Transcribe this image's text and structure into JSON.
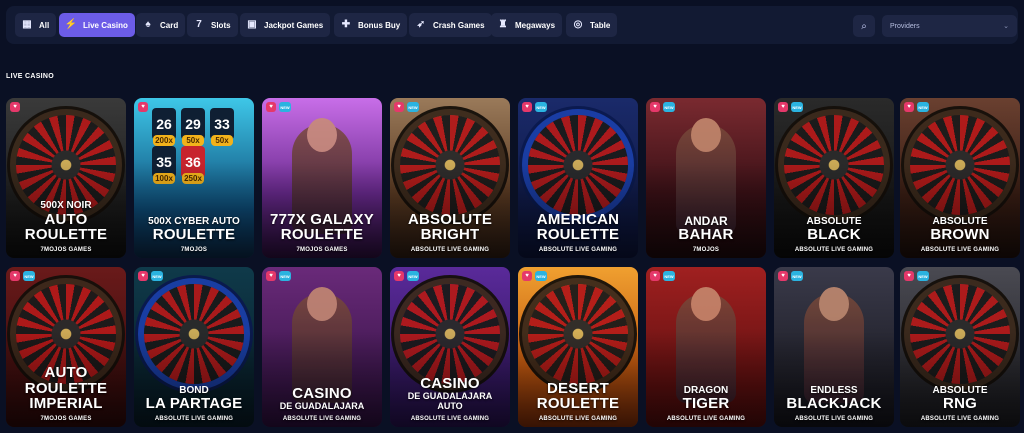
{
  "filters": [
    {
      "label": "All",
      "icon": "grid-icon",
      "glyph": "▦",
      "active": false
    },
    {
      "label": "Live Casino",
      "icon": "lightning-icon",
      "glyph": "⚡",
      "active": true
    },
    {
      "label": "Card",
      "icon": "cards-icon",
      "glyph": "♠",
      "active": false
    },
    {
      "label": "Slots",
      "icon": "seven-icon",
      "glyph": "7",
      "active": false
    },
    {
      "label": "Jackpot Games",
      "icon": "ticket-icon",
      "glyph": "▣",
      "active": false
    },
    {
      "label": "Bonus Buy",
      "icon": "gift-icon",
      "glyph": "✚",
      "active": false
    },
    {
      "label": "Crash Games",
      "icon": "rocket-icon",
      "glyph": "➶",
      "active": false
    },
    {
      "label": "Megaways",
      "icon": "bag-icon",
      "glyph": "♜",
      "active": false
    },
    {
      "label": "Table",
      "icon": "roulette-icon",
      "glyph": "◎",
      "active": false
    }
  ],
  "search_glyph": "⌕",
  "provider": {
    "label": "Providers",
    "chev": "⌄"
  },
  "section_title": "LIVE CASINO",
  "badges": {
    "hot": "♥",
    "new": "NEW"
  },
  "grid_numbers": {
    "n1": "26",
    "m1": "200x",
    "n2": "29",
    "m2": "50x",
    "n3": "33",
    "m3": "50x",
    "n4": "35",
    "m4": "100x",
    "n5": "36",
    "m5": "250x"
  },
  "games": [
    {
      "l1": "500X NOIR",
      "l2": "AUTO",
      "l3": "",
      "l4": "ROULETTE",
      "provider": "7MOJOS GAMES"
    },
    {
      "l1": "500X CYBER AUTO",
      "l2": "",
      "l3": "",
      "l4": "ROULETTE",
      "provider": "7MOJOS"
    },
    {
      "l1": "",
      "l2": "777X GALAXY",
      "l3": "",
      "l4": "ROULETTE",
      "provider": "7MOJOS GAMES"
    },
    {
      "l1": "",
      "l2": "ABSOLUTE",
      "l3": "",
      "l4": "BRIGHT",
      "provider": "ABSOLUTE LIVE GAMING"
    },
    {
      "l1": "",
      "l2": "AMERICAN",
      "l3": "",
      "l4": "ROULETTE",
      "provider": "ABSOLUTE LIVE GAMING"
    },
    {
      "l1": "ANDAR",
      "l2": "",
      "l3": "",
      "l4": "BAHAR",
      "provider": "7MOJOS"
    },
    {
      "l1": "ABSOLUTE",
      "l2": "",
      "l3": "",
      "l4": "BLACK",
      "provider": "ABSOLUTE LIVE GAMING"
    },
    {
      "l1": "ABSOLUTE",
      "l2": "",
      "l3": "",
      "l4": "BROWN",
      "provider": "ABSOLUTE LIVE GAMING"
    },
    {
      "l1": "",
      "l2": "AUTO",
      "l3": "ROULETTE",
      "l4": "IMPERIAL",
      "provider": "7MOJOS GAMES"
    },
    {
      "l1": "BOND",
      "l2": "",
      "l3": "",
      "l4": "LA PARTAGE",
      "provider": "ABSOLUTE LIVE GAMING"
    },
    {
      "l1": "",
      "l2": "CASINO",
      "l3": "DE GUADALAJARA",
      "l4": "",
      "provider": "ABSOLUTE LIVE GAMING"
    },
    {
      "l1": "",
      "l2": "CASINO",
      "l3": "DE GUADALAJARA",
      "l4": "AUTO",
      "provider": "ABSOLUTE LIVE GAMING"
    },
    {
      "l1": "",
      "l2": "DESERT",
      "l3": "",
      "l4": "ROULETTE",
      "provider": "ABSOLUTE LIVE GAMING"
    },
    {
      "l1": "DRAGON",
      "l2": "",
      "l3": "",
      "l4": "TIGER",
      "provider": "ABSOLUTE LIVE GAMING"
    },
    {
      "l1": "ENDLESS",
      "l2": "",
      "l3": "",
      "l4": "BLACKJACK",
      "provider": "ABSOLUTE LIVE GAMING"
    },
    {
      "l1": "ABSOLUTE",
      "l2": "",
      "l3": "",
      "l4": "RNG",
      "provider": "ABSOLUTE LIVE GAMING"
    }
  ],
  "colors": {
    "page_bg": "#0a1024",
    "bar_bg": "#121a33",
    "chip_bg": "#1e2644",
    "active": "#6c5ce7",
    "hot": "#e5386a",
    "new": "#2bb3e0"
  }
}
